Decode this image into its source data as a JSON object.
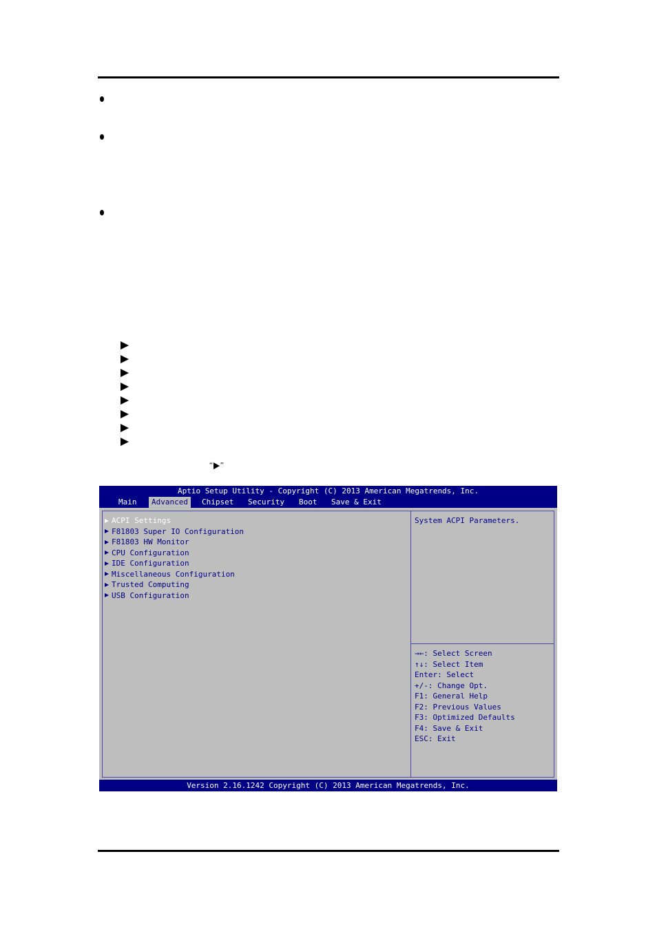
{
  "document": {
    "bullet_count": 3,
    "submenu_arrow_count": 8,
    "inline_symbol": {
      "open_quote": "“",
      "close_quote": "”"
    }
  },
  "bios": {
    "title": "Aptio Setup Utility - Copyright (C) 2013 American Megatrends, Inc.",
    "tabs": [
      {
        "label": "Main",
        "active": false
      },
      {
        "label": "Advanced",
        "active": true
      },
      {
        "label": "Chipset",
        "active": false
      },
      {
        "label": "Security",
        "active": false
      },
      {
        "label": "Boot",
        "active": false
      },
      {
        "label": "Save & Exit",
        "active": false
      }
    ],
    "menu_items": [
      {
        "label": "ACPI Settings",
        "selected": true
      },
      {
        "label": "F81803 Super IO Configuration",
        "selected": false
      },
      {
        "label": "F81803 HW Monitor",
        "selected": false
      },
      {
        "label": "CPU Configuration",
        "selected": false
      },
      {
        "label": "IDE Configuration",
        "selected": false
      },
      {
        "label": "Miscellaneous Configuration",
        "selected": false
      },
      {
        "label": "Trusted Computing",
        "selected": false
      },
      {
        "label": "USB Configuration",
        "selected": false
      }
    ],
    "help_text": "System ACPI Parameters.",
    "key_hints": [
      "→←: Select Screen",
      "↑↓: Select Item",
      "Enter: Select",
      "+/-: Change Opt.",
      "F1: General Help",
      "F2: Previous Values",
      "F3: Optimized Defaults",
      "F4: Save & Exit",
      "ESC: Exit"
    ],
    "footer": "Version 2.16.1242 Copyright (C) 2013 American Megatrends, Inc.",
    "colors": {
      "bar_blue": "#000084",
      "panel_gray": "#bebebe",
      "text_blue": "#000084",
      "selected_text": "#ffffff"
    }
  }
}
